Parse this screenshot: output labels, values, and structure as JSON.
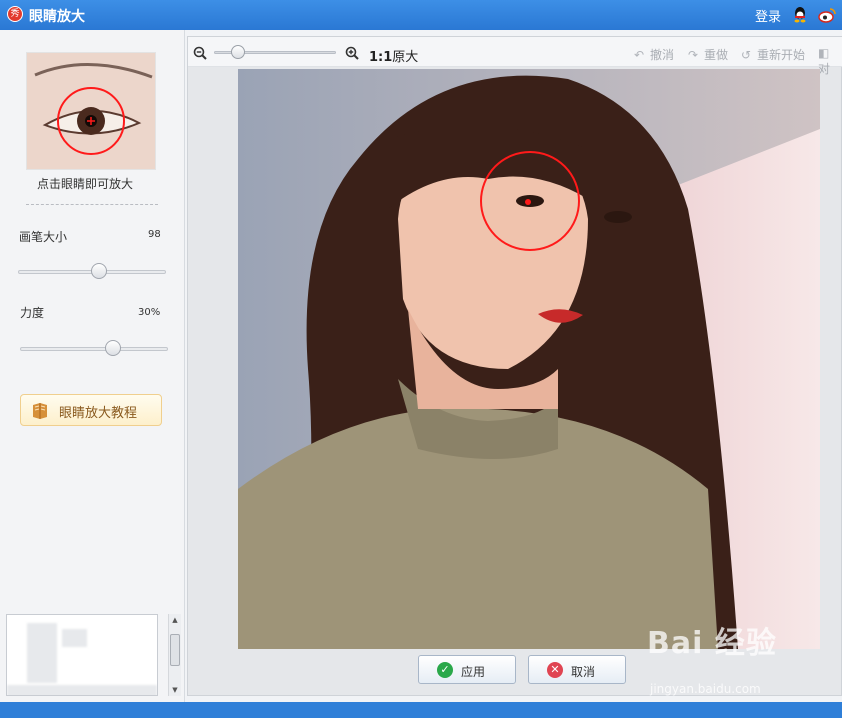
{
  "titlebar": {
    "title": "眼睛放大",
    "app_icon_text": "秀",
    "login": "登录"
  },
  "left_panel": {
    "hint": "点击眼睛即可放大",
    "brush_size": {
      "label": "画笔大小",
      "value": "98",
      "level": 0.55
    },
    "strength": {
      "label": "力度",
      "value": "30%",
      "level": 0.63
    },
    "tutorial_button": "眼睛放大教程"
  },
  "toolbar": {
    "zoom_level": 0.2,
    "one_to_one_bold": "1:1",
    "one_to_one": "原大",
    "undo": "撤消",
    "redo": "重做",
    "restart": "重新开始",
    "compare": "对"
  },
  "actions": {
    "apply": "应用",
    "cancel": "取消"
  },
  "watermark": {
    "brand": "Bai 经验",
    "url": "jingyan.baidu.com"
  },
  "colors": {
    "titlebar": "#2f7fd8",
    "marker": "#ff1a1a",
    "apply_icon": "#2aa84a",
    "cancel_icon": "#e04452"
  }
}
